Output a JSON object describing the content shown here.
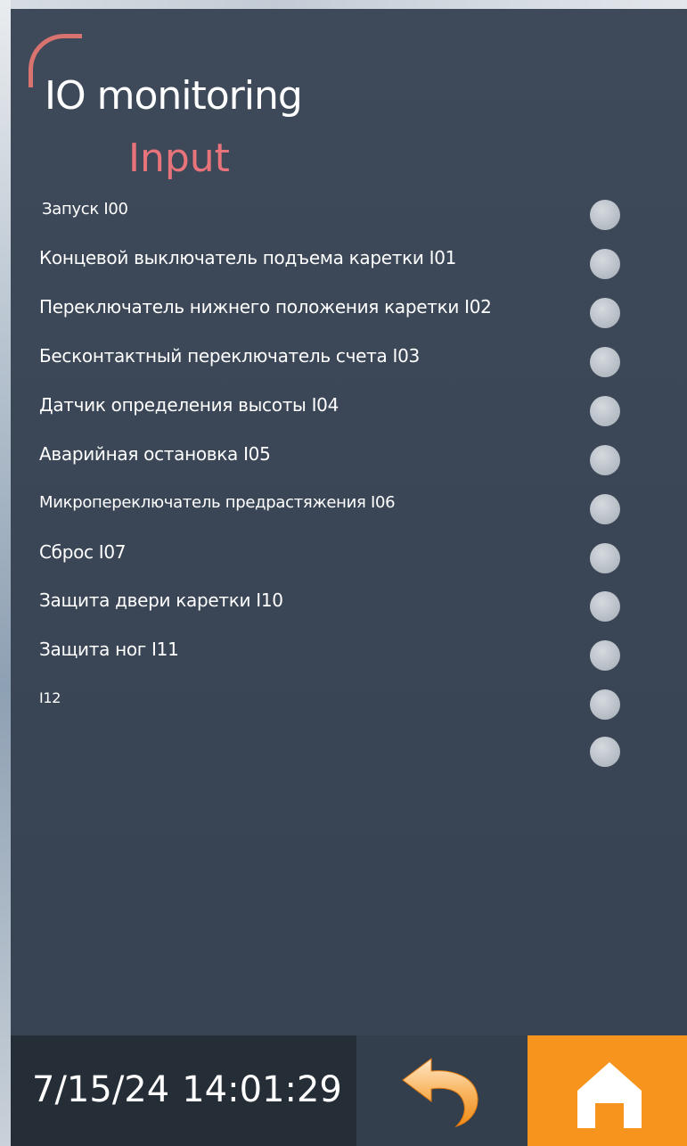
{
  "header": {
    "title": "IO monitoring",
    "subtitle": "Input"
  },
  "inputs": [
    {
      "label": "Запуск I00",
      "state": "off"
    },
    {
      "label": "Концевой выключатель подъема каретки I01",
      "state": "off"
    },
    {
      "label": "Переключатель нижнего положения каретки I02",
      "state": "off"
    },
    {
      "label": "Бесконтактный переключатель счета I03",
      "state": "off"
    },
    {
      "label": "Датчик определения высоты I04",
      "state": "off"
    },
    {
      "label": "Аварийная остановка I05",
      "state": "off"
    },
    {
      "label": "Микропереключатель предрастяжения I06",
      "state": "off"
    },
    {
      "label": "Сброс I07",
      "state": "off"
    },
    {
      "label": "Защита двери каретки I10",
      "state": "off"
    },
    {
      "label": "Защита ног I11",
      "state": "off"
    },
    {
      "label": "I12",
      "state": "off"
    },
    {
      "label": "",
      "state": "off"
    }
  ],
  "footer": {
    "date": "7/15/24",
    "time": "14:01:29",
    "back_icon": "back-arrow-icon",
    "home_icon": "home-icon"
  },
  "colors": {
    "background": "#3a4656",
    "title": "#ffffff",
    "subtitle": "#e8737a",
    "logo_arc": "#d9736f",
    "indicator_off": "#b3bac2",
    "datetime_bg": "#252d36",
    "back_bg": "#343f4d",
    "home_bg": "#f7941d"
  }
}
